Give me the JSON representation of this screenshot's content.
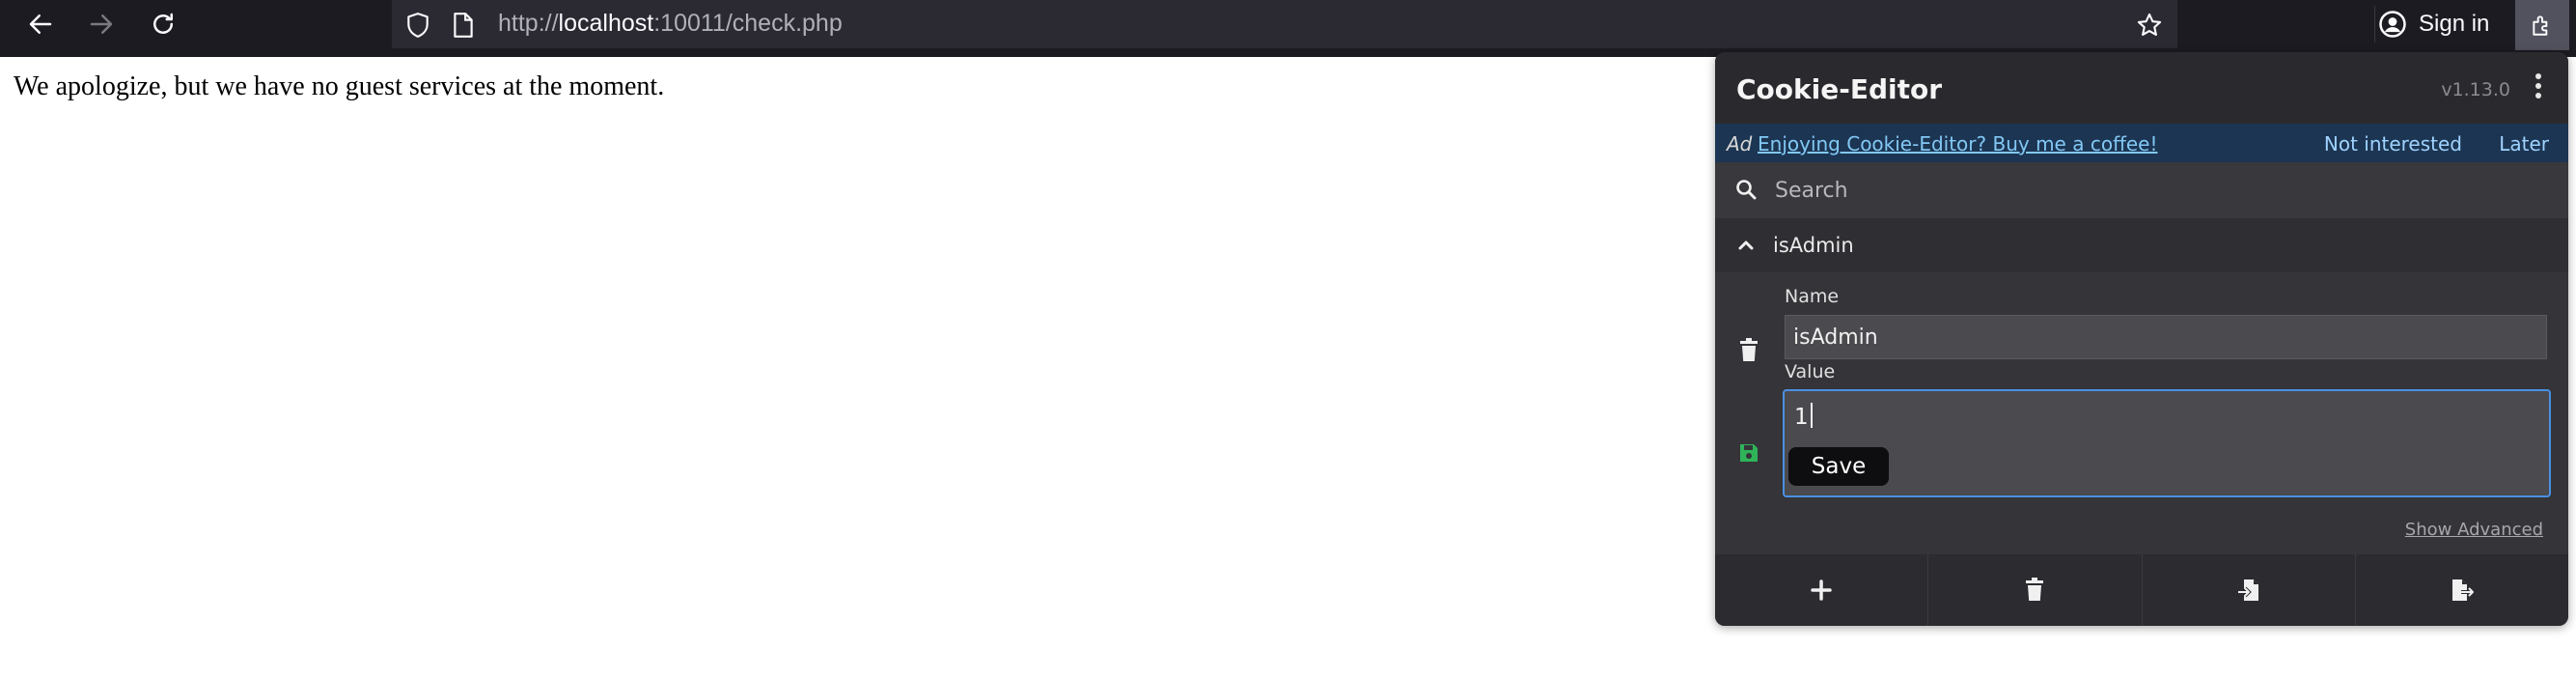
{
  "browser": {
    "url_prefix": "http://",
    "url_host": "localhost",
    "url_rest": ":10011/check.php",
    "signin_label": "Sign in",
    "icons": [
      "back-icon",
      "forward-icon",
      "reload-icon",
      "shield-icon",
      "page-icon",
      "star-icon",
      "account-icon",
      "extensions-icon"
    ]
  },
  "page": {
    "message": "We apologize, but we have no guest services at the moment."
  },
  "cookie_editor": {
    "title": "Cookie-Editor",
    "version": "v1.13.0",
    "ad": {
      "tag": "Ad",
      "link": "Enjoying Cookie-Editor? Buy me a coffee!",
      "not_interested": "Not interested",
      "later": "Later"
    },
    "search_placeholder": "Search",
    "cookie": {
      "header_name": "isAdmin",
      "name_label": "Name",
      "name_value": "isAdmin",
      "value_label": "Value",
      "value_value": "1",
      "save_tooltip": "Save",
      "show_advanced": "Show Advanced"
    },
    "footer_icons": [
      "add-icon",
      "delete-all-icon",
      "import-icon",
      "export-icon"
    ],
    "colors": {
      "accent": "#4a90e2",
      "save_icon": "#2fb45a",
      "ad_bg": "#1c3552"
    }
  }
}
